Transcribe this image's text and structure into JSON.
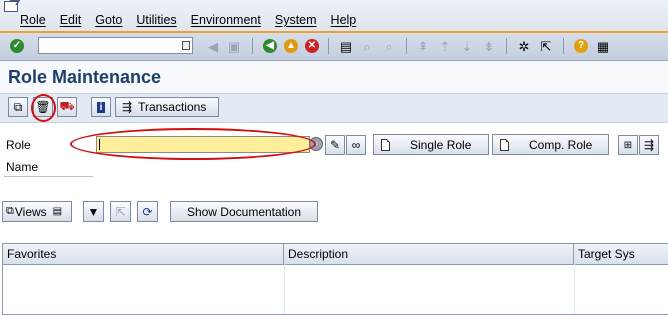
{
  "menu": {
    "items": [
      "Role",
      "Edit",
      "Goto",
      "Utilities",
      "Environment",
      "System",
      "Help"
    ]
  },
  "system_toolbar": {
    "command_field_value": "",
    "icons": [
      "enter-icon",
      "back-icon",
      "exit-icon",
      "cancel-icon",
      "print-icon",
      "find-icon",
      "find-next-icon",
      "first-page-icon",
      "previous-page-icon",
      "next-page-icon",
      "last-page-icon",
      "create-session-icon",
      "shortcut-icon",
      "help-icon",
      "layout-icon"
    ]
  },
  "page": {
    "title": "Role Maintenance"
  },
  "app_toolbar": {
    "transactions_label": "Transactions"
  },
  "form": {
    "role_label": "Role",
    "role_value": "",
    "name_label": "Name",
    "single_role_label": "Single Role",
    "comp_role_label": "Comp. Role"
  },
  "tree_toolbar": {
    "views_label": "Views",
    "show_documentation_label": "Show Documentation",
    "dots": "....."
  },
  "table": {
    "columns": [
      "Favorites",
      "Description",
      "Target Sys"
    ],
    "rows": []
  },
  "colors": {
    "title": "#1c3f6e",
    "role_input_bg": "#ffef9c",
    "highlight_circle": "#d01010",
    "menu_underline": "#f0a030"
  }
}
